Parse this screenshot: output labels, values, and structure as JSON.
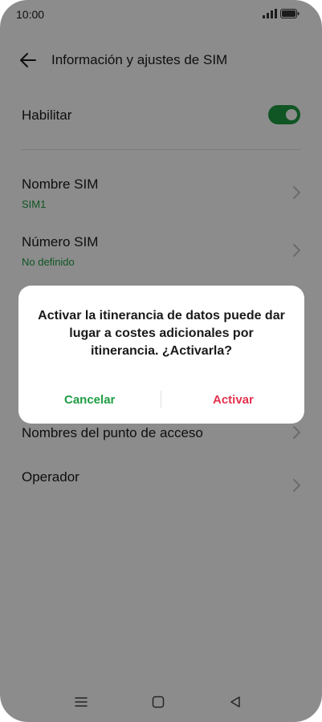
{
  "status_bar": {
    "time": "10:00"
  },
  "app_bar": {
    "title": "Información y ajustes de SIM"
  },
  "settings": {
    "enable_label": "Habilitar",
    "sim_name_label": "Nombre SIM",
    "sim_name_value": "SIM1",
    "sim_number_label": "Número SIM",
    "sim_number_value": "No definido",
    "apn_label": "Nombres del punto de acceso",
    "operator_label": "Operador"
  },
  "dialog": {
    "message": "Activar la itinerancia de datos puede dar lugar a costes adicionales por itinerancia. ¿Activarla?",
    "cancel_label": "Cancelar",
    "activate_label": "Activar"
  },
  "colors": {
    "accent": "#1e9c42",
    "danger": "#e2324e",
    "scrim": "#7a7a7a"
  },
  "icons": [
    "back-arrow-icon",
    "chevron-right-icon",
    "signal-icon",
    "battery-icon",
    "menu-icon",
    "home-icon",
    "back-icon"
  ]
}
